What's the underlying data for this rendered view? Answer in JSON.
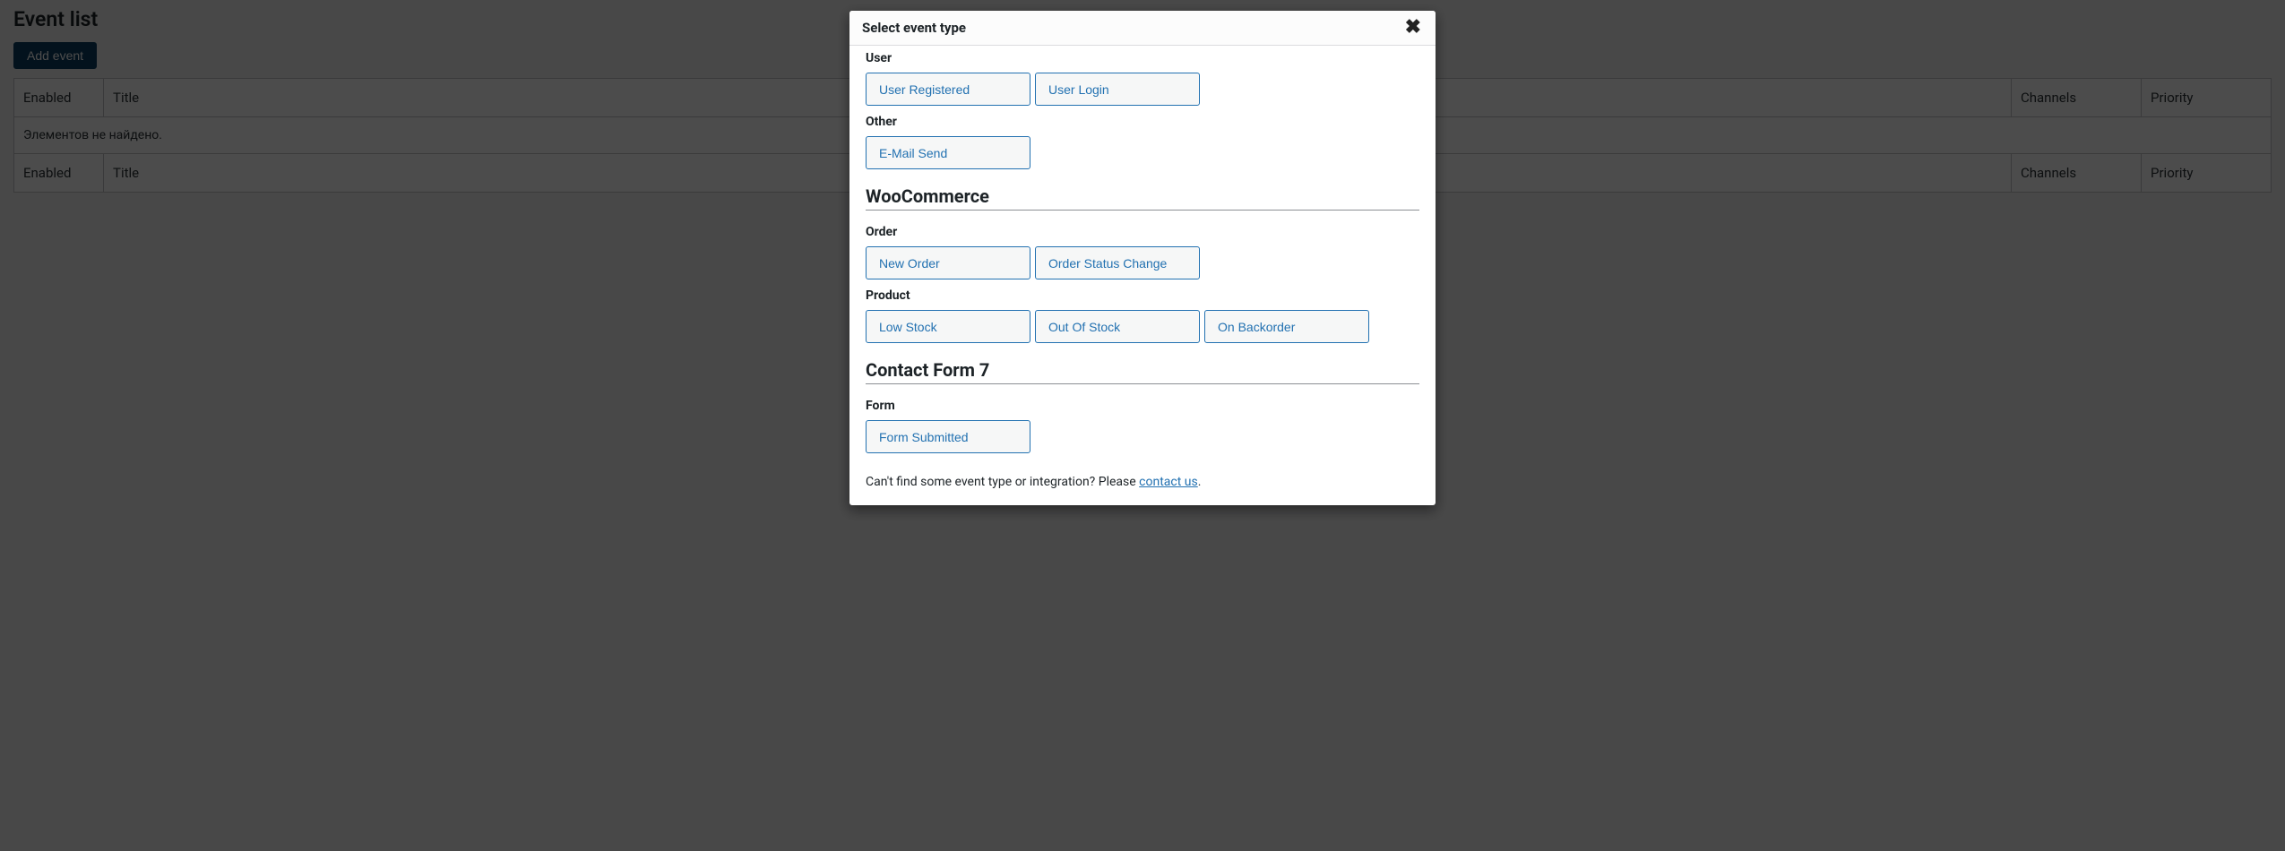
{
  "page": {
    "title": "Event list",
    "add_button": "Add event",
    "table": {
      "headers": {
        "enabled": "Enabled",
        "title": "Title",
        "channels": "Channels",
        "priority": "Priority"
      },
      "empty_text": "Элементов не найдено."
    }
  },
  "modal": {
    "title": "Select event type",
    "sections": [
      {
        "categories": [
          {
            "label": "User",
            "first": true,
            "items": [
              "User Registered",
              "User Login"
            ]
          },
          {
            "label": "Other",
            "items": [
              "E-Mail Send"
            ]
          }
        ]
      },
      {
        "title": "WooCommerce",
        "categories": [
          {
            "label": "Order",
            "items": [
              "New Order",
              "Order Status Change"
            ]
          },
          {
            "label": "Product",
            "items": [
              "Low Stock",
              "Out Of Stock",
              "On Backorder"
            ]
          }
        ]
      },
      {
        "title": "Contact Form 7",
        "categories": [
          {
            "label": "Form",
            "items": [
              "Form Submitted"
            ]
          }
        ]
      }
    ],
    "footer_prefix": "Can't find some event type or integration? Please ",
    "footer_link": "contact us",
    "footer_suffix": "."
  }
}
